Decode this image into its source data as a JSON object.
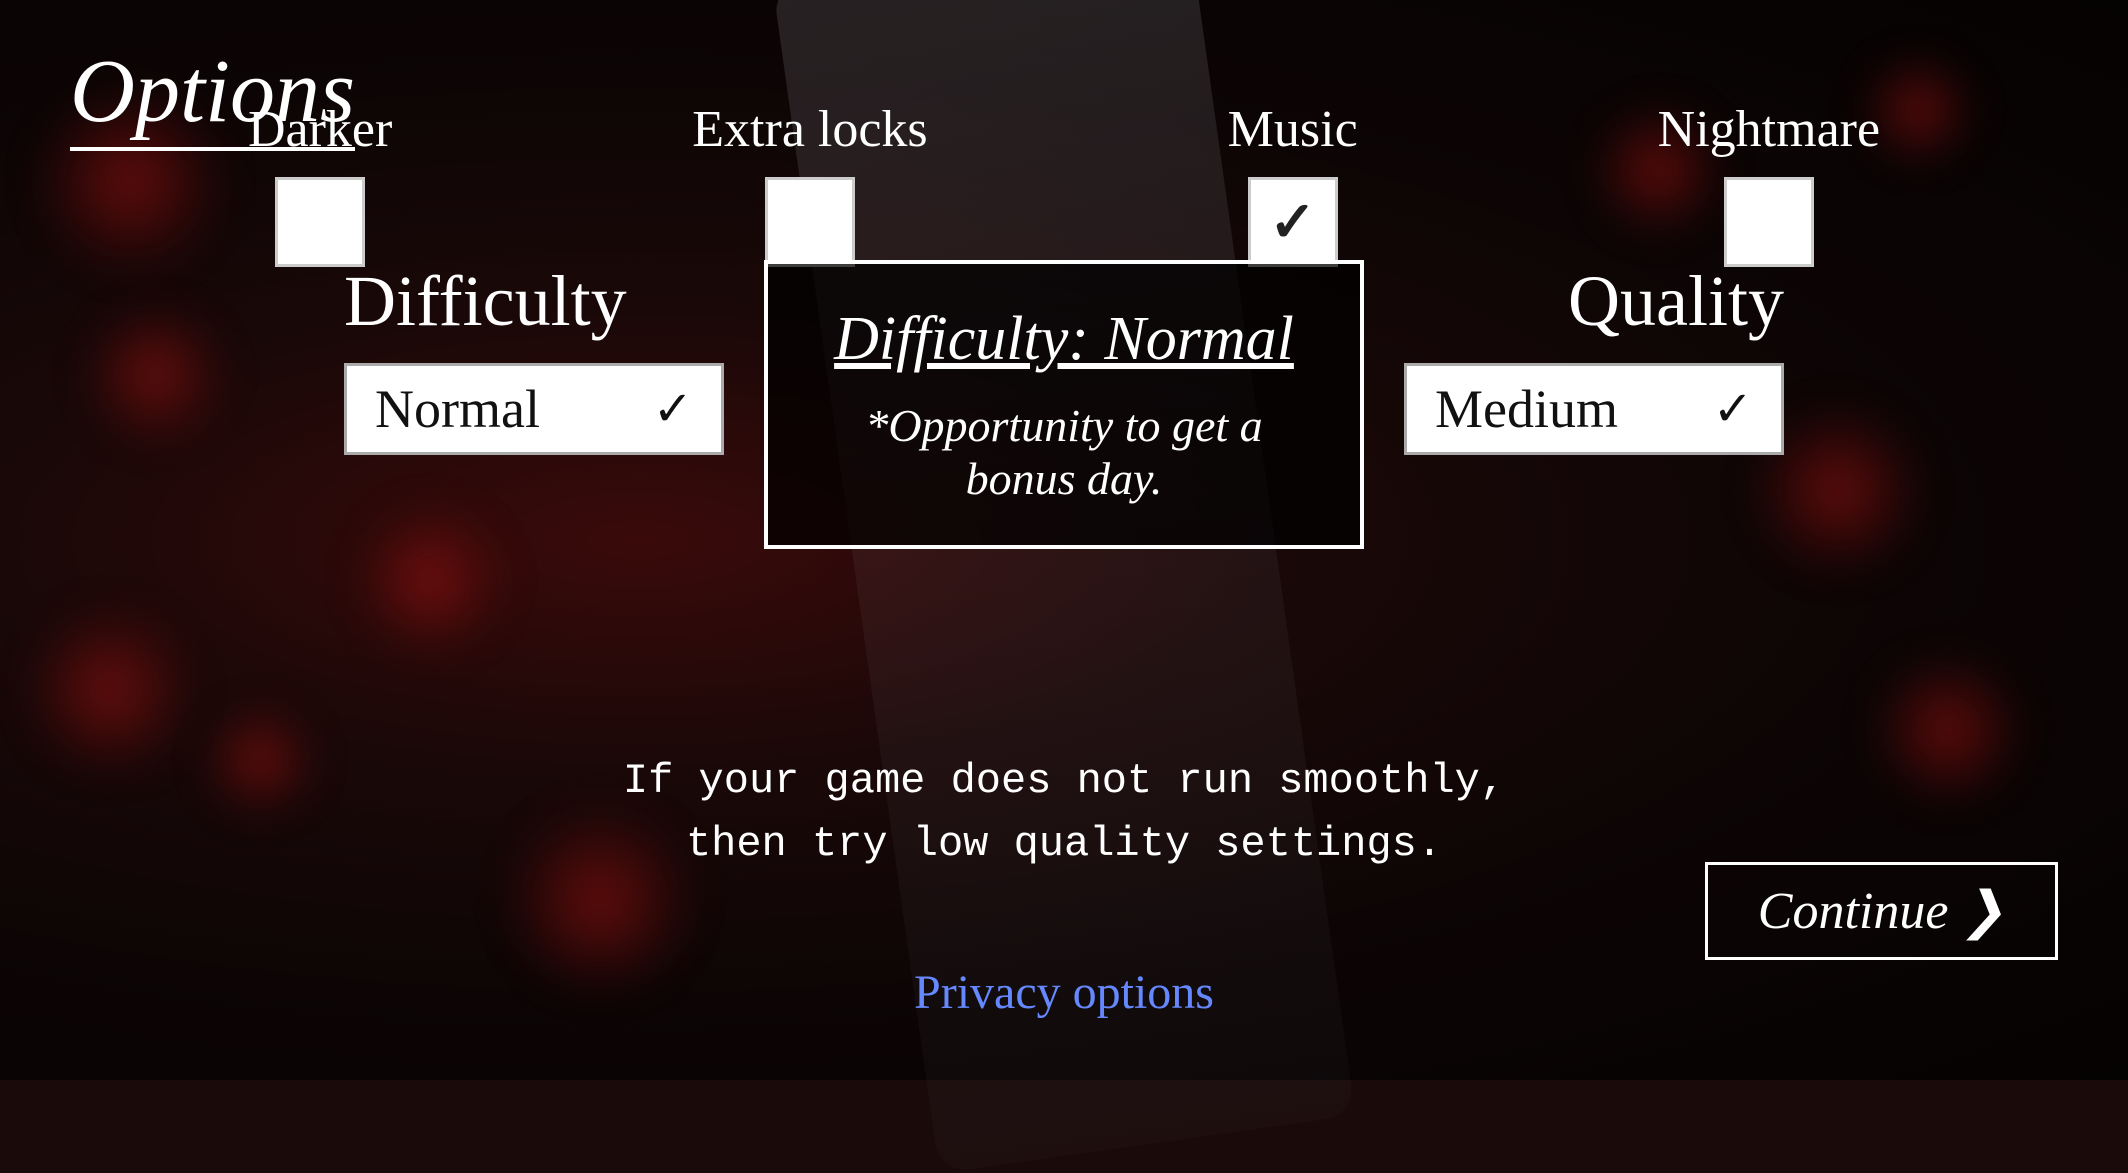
{
  "title": "Options",
  "checkboxes": [
    {
      "label": "Darker",
      "checked": false
    },
    {
      "label": "Extra locks",
      "checked": false
    },
    {
      "label": "Music",
      "checked": true
    },
    {
      "label": "Nightmare",
      "checked": false
    }
  ],
  "difficulty": {
    "section_title": "Difficulty",
    "current_value": "Normal",
    "arrow": "✓"
  },
  "difficulty_box": {
    "title": "Difficulty: Normal",
    "description": "*Opportunity to get a bonus day."
  },
  "quality": {
    "section_title": "Quality",
    "current_value": "Medium",
    "arrow": "✓"
  },
  "performance_hint": {
    "line1": "If your game does not run smoothly,",
    "line2": "then try low quality settings."
  },
  "continue_button": "Continue ❯",
  "privacy_options": "Privacy options"
}
